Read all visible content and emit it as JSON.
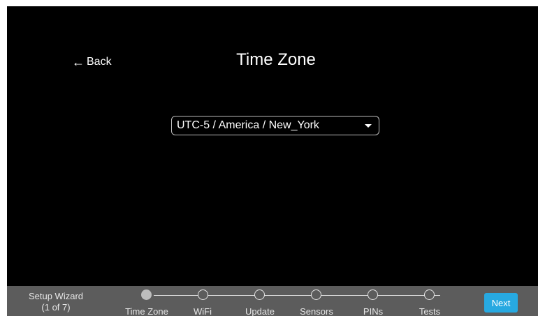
{
  "header": {
    "back_label": "Back",
    "title": "Time Zone"
  },
  "timezone_select": {
    "value": "UTC-5 / America / New_York"
  },
  "footer": {
    "wizard_title": "Setup Wizard",
    "wizard_progress": "(1 of 7)",
    "steps": [
      {
        "label": "Time Zone",
        "active": true
      },
      {
        "label": "WiFi",
        "active": false
      },
      {
        "label": "Update",
        "active": false
      },
      {
        "label": "Sensors",
        "active": false
      },
      {
        "label": "PINs",
        "active": false
      },
      {
        "label": "Tests",
        "active": false
      }
    ],
    "next_label": "Next"
  },
  "colors": {
    "background": "#000000",
    "footer_bar": "#5c5c5c",
    "accent": "#27a9e1",
    "text": "#ffffff"
  },
  "icons": {
    "back": "arrow-left-icon",
    "dropdown": "caret-down-icon"
  }
}
